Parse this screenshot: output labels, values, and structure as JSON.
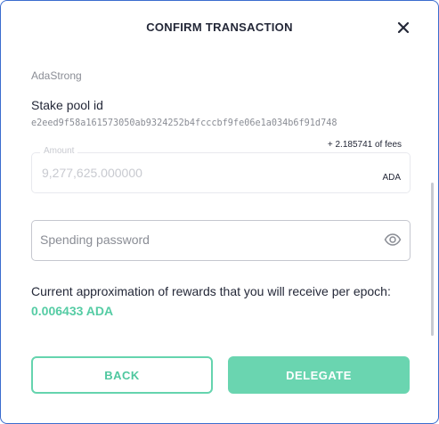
{
  "dialog": {
    "title": "CONFIRM TRANSACTION",
    "close_icon": "close-icon"
  },
  "pool": {
    "name": "AdaStrong",
    "id_label": "Stake pool id",
    "id": "e2eed9f58a161573050ab9324252b4fcccbf9fe06e1a034b6f91d748"
  },
  "amount": {
    "label": "Amount",
    "value": "9,277,625.000000",
    "currency": "ADA",
    "fees": "+ 2.185741 of fees"
  },
  "password": {
    "placeholder": "Spending password",
    "value": "",
    "toggle_icon": "eye-icon"
  },
  "rewards": {
    "text": "Current approximation of rewards that you will receive per epoch:",
    "value": "0.006433 ADA"
  },
  "buttons": {
    "back_label": "BACK",
    "delegate_label": "DELEGATE"
  },
  "colors": {
    "accent": "#55cca4",
    "primary_button": "#6ad5b0",
    "text": "#242838",
    "muted": "#8a8d95",
    "frame_border": "#3b6ccf"
  }
}
